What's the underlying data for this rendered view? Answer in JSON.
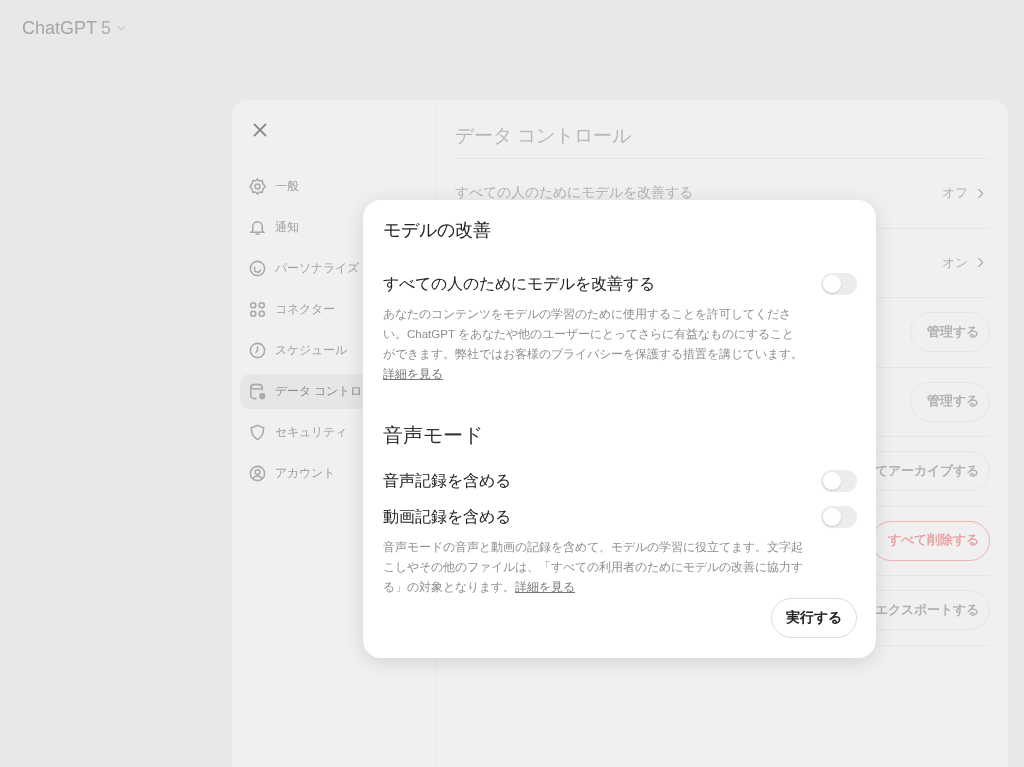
{
  "app": {
    "title": "ChatGPT",
    "model": "5"
  },
  "settings": {
    "title": "データ コントロール",
    "sidebar": [
      {
        "label": "一般",
        "selected": false
      },
      {
        "label": "通知",
        "selected": false
      },
      {
        "label": "パーソナライズ",
        "selected": false
      },
      {
        "label": "コネクター",
        "selected": false
      },
      {
        "label": "スケジュール",
        "selected": false
      },
      {
        "label": "データ コントロ",
        "selected": true
      },
      {
        "label": "セキュリティ",
        "selected": false
      },
      {
        "label": "アカウント",
        "selected": false
      }
    ],
    "rows": [
      {
        "kind": "value",
        "label": "すべての人のためにモデルを改善する",
        "value": "オフ"
      },
      {
        "kind": "value",
        "value": "オン"
      },
      {
        "kind": "button",
        "action": "管理する"
      },
      {
        "kind": "button",
        "action": "管理する"
      },
      {
        "kind": "button",
        "action": "てアーカイブする"
      },
      {
        "kind": "danger",
        "action": "すべて削除する"
      },
      {
        "kind": "button",
        "action": "エクスポートする"
      }
    ]
  },
  "dialog": {
    "sections": [
      {
        "heading": "モデルの改善",
        "toggles": [
          {
            "label": "すべての人のためにモデルを改善する",
            "on": false
          }
        ],
        "description": "あなたのコンテンツをモデルの学習のために使用することを許可してください。ChatGPT をあなたや他のユーザーにとってさらに有益なものにすることができます。弊社ではお客様のプライバシーを保護する措置を講じています。",
        "link": "詳細を見る"
      },
      {
        "heading": "音声モード",
        "toggles": [
          {
            "label": "音声記録を含める",
            "on": false
          },
          {
            "label": "動画記録を含める",
            "on": false
          }
        ],
        "description": "音声モードの音声と動画の記録を含めて、モデルの学習に役立てます。文字起こしやその他のファイルは、「すべての利用者のためにモデルの改善に協力する」の対象となります。",
        "link": "詳細を見る"
      }
    ],
    "action": "実行する"
  }
}
